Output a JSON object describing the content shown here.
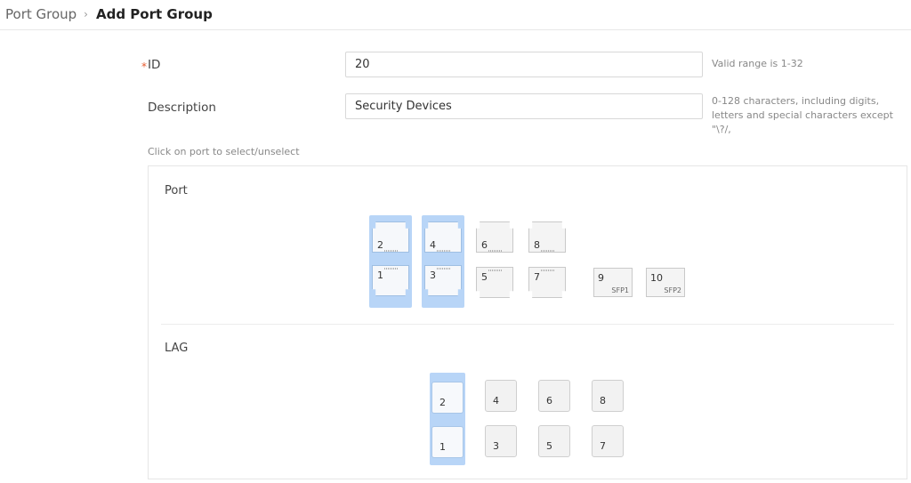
{
  "breadcrumb": {
    "parent": "Port Group",
    "separator": "›",
    "current": "Add Port Group"
  },
  "form": {
    "id": {
      "label": "ID",
      "required_mark": "*",
      "value": "20",
      "hint": "Valid range is 1-32"
    },
    "description": {
      "label": "Description",
      "value": "Security Devices",
      "hint": "0-128 characters, including digits, letters and special characters except \"\\?/,"
    },
    "instruction": "Click on port to select/unselect"
  },
  "ports_section": {
    "title": "Port",
    "ports": [
      {
        "label": "2",
        "selected": true
      },
      {
        "label": "1",
        "selected": true
      },
      {
        "label": "4",
        "selected": true
      },
      {
        "label": "3",
        "selected": true
      },
      {
        "label": "6",
        "selected": false
      },
      {
        "label": "5",
        "selected": false
      },
      {
        "label": "8",
        "selected": false
      },
      {
        "label": "7",
        "selected": false
      }
    ],
    "sfp": [
      {
        "label": "9",
        "sub": "SFP1",
        "selected": false
      },
      {
        "label": "10",
        "sub": "SFP2",
        "selected": false
      }
    ]
  },
  "lag_section": {
    "title": "LAG",
    "lags": [
      {
        "label": "2",
        "selected": true
      },
      {
        "label": "1",
        "selected": true
      },
      {
        "label": "4",
        "selected": false
      },
      {
        "label": "3",
        "selected": false
      },
      {
        "label": "6",
        "selected": false
      },
      {
        "label": "5",
        "selected": false
      },
      {
        "label": "8",
        "selected": false
      },
      {
        "label": "7",
        "selected": false
      }
    ]
  },
  "colors": {
    "selected_highlight": "#b8d5f7",
    "required": "#e65a2e"
  }
}
